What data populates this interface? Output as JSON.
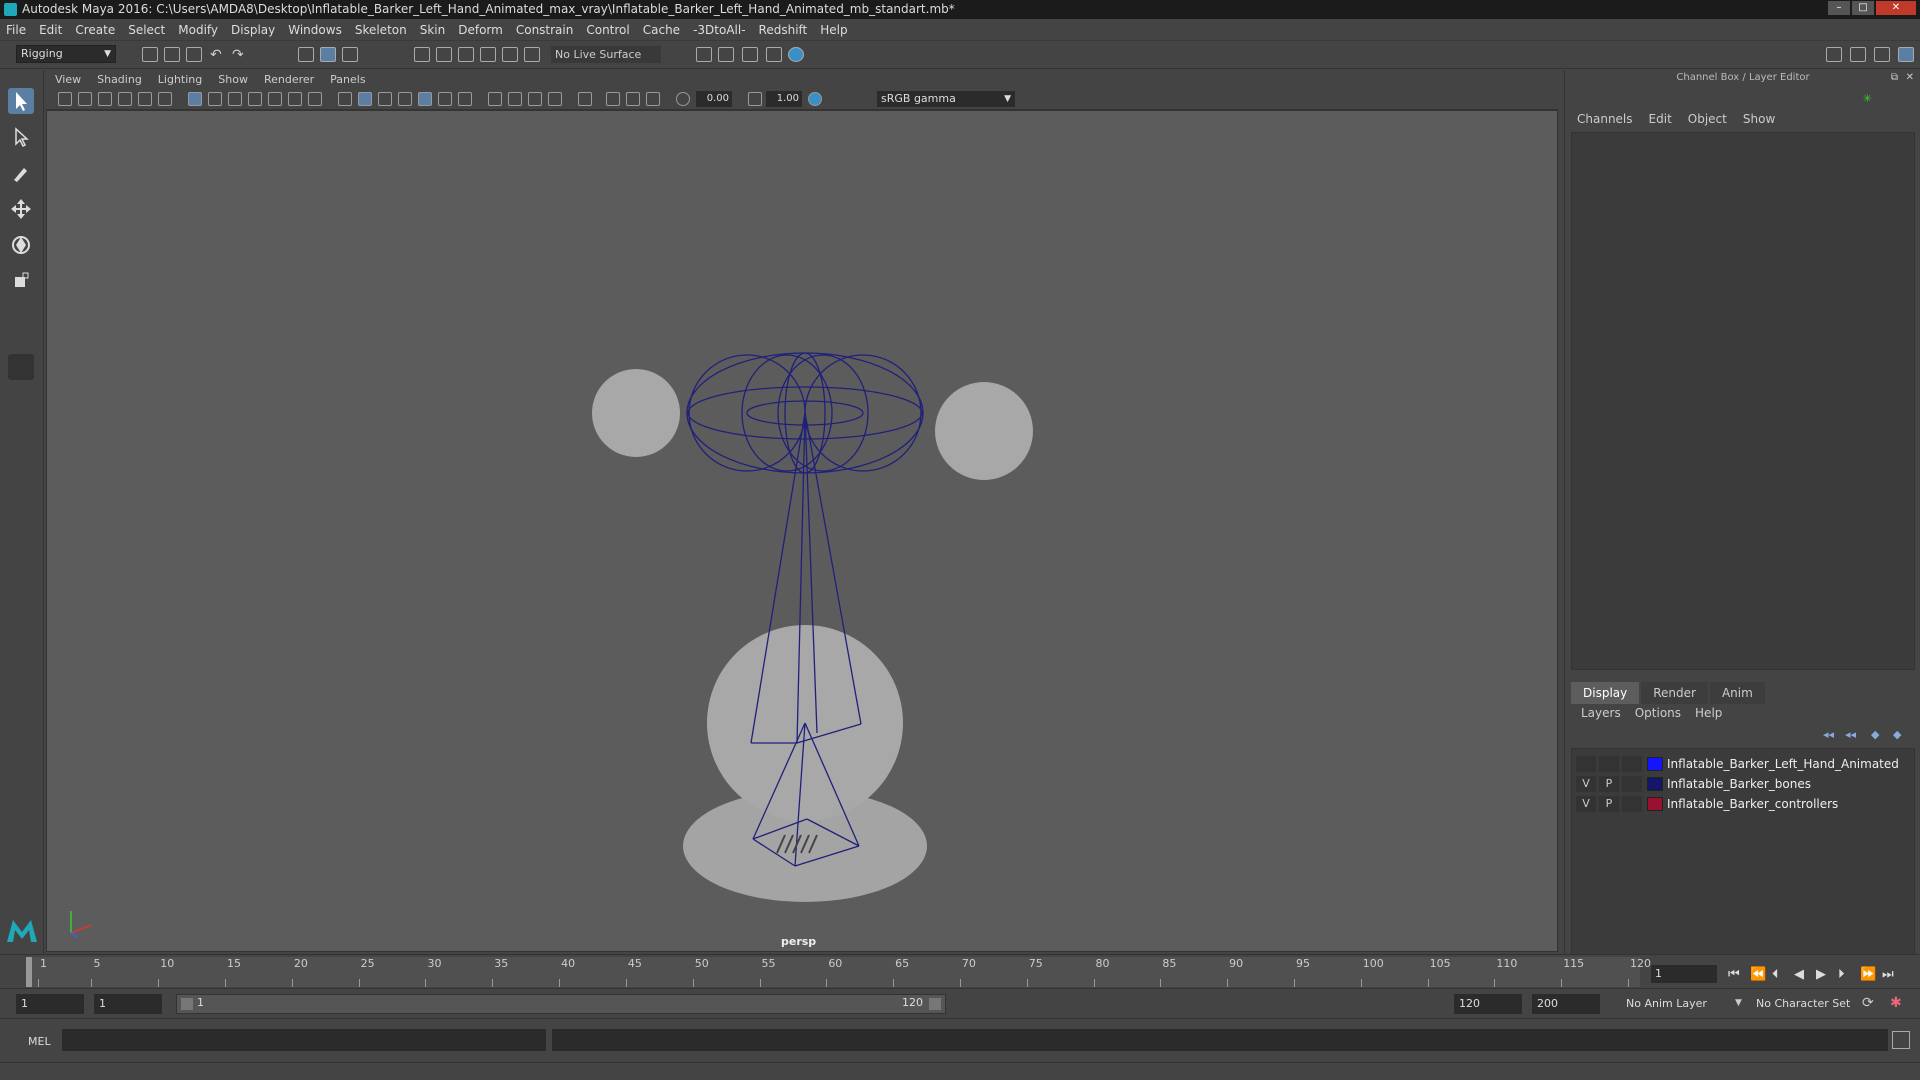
{
  "window": {
    "title": "Autodesk Maya 2016: C:\\Users\\AMDA8\\Desktop\\Inflatable_Barker_Left_Hand_Animated_max_vray\\Inflatable_Barker_Left_Hand_Animated_mb_standart.mb*"
  },
  "menubar": [
    "File",
    "Edit",
    "Create",
    "Select",
    "Modify",
    "Display",
    "Windows",
    "Skeleton",
    "Skin",
    "Deform",
    "Constrain",
    "Control",
    "Cache",
    "-3DtoAll-",
    "Redshift",
    "Help"
  ],
  "shelf": {
    "mode": "Rigging",
    "live_surface": "No Live Surface"
  },
  "panel_menu": [
    "View",
    "Shading",
    "Lighting",
    "Show",
    "Renderer",
    "Panels"
  ],
  "viewport": {
    "exposure": "0.00",
    "gamma_value": "1.00",
    "color_space": "sRGB gamma",
    "camera": "persp",
    "wire_color": "#20207a"
  },
  "channel_box": {
    "title": "Channel Box / Layer Editor",
    "menu": [
      "Channels",
      "Edit",
      "Object",
      "Show"
    ]
  },
  "layer_editor": {
    "tabs": [
      "Display",
      "Render",
      "Anim"
    ],
    "menu": [
      "Layers",
      "Options",
      "Help"
    ],
    "layers": [
      {
        "v": "",
        "p": "",
        "color": "#1414ff",
        "name": "Inflatable_Barker_Left_Hand_Animated"
      },
      {
        "v": "V",
        "p": "P",
        "color": "#141468",
        "name": "Inflatable_Barker_bones"
      },
      {
        "v": "V",
        "p": "P",
        "color": "#9a1030",
        "name": "Inflatable_Barker_controllers"
      }
    ]
  },
  "timeline": {
    "ticks": [
      "1",
      "5",
      "10",
      "15",
      "20",
      "25",
      "30",
      "35",
      "40",
      "45",
      "50",
      "55",
      "60",
      "65",
      "70",
      "75",
      "80",
      "85",
      "90",
      "95",
      "100",
      "105",
      "110",
      "115",
      "120"
    ],
    "current_frame": "1"
  },
  "range": {
    "start": "1",
    "playback_start": "1",
    "slider_start": "1",
    "slider_end": "120",
    "playback_end": "120",
    "end": "200",
    "anim_layer": "No Anim Layer",
    "character_set": "No Character Set"
  },
  "command_line": {
    "label": "MEL"
  }
}
